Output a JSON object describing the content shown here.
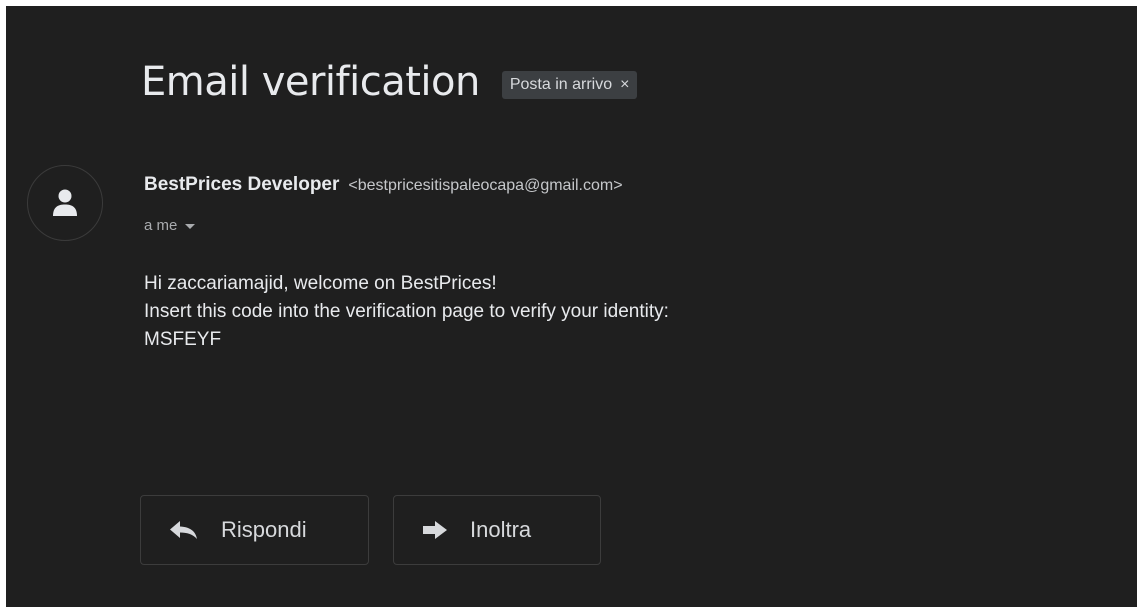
{
  "email": {
    "subject": "Email verification",
    "label_chip": {
      "text": "Posta in arrivo",
      "close_glyph": "×"
    },
    "sender": {
      "name": "BestPrices Developer",
      "email": "<bestpricesitispaleocapa@gmail.com>",
      "avatar_icon": "person-icon"
    },
    "recipient": "a me",
    "body_lines": [
      "Hi zaccariamajid, welcome on BestPrices!",
      "Insert this code into the verification page to verify your identity:",
      "MSFEYF"
    ]
  },
  "actions": {
    "reply_label": "Rispondi",
    "reply_icon": "reply-icon",
    "forward_label": "Inoltra",
    "forward_icon": "forward-icon"
  },
  "colors": {
    "background": "#1f1f1f",
    "text": "#e8eaed",
    "chip_background": "#3c3f42",
    "border": "#3c3c3c"
  }
}
